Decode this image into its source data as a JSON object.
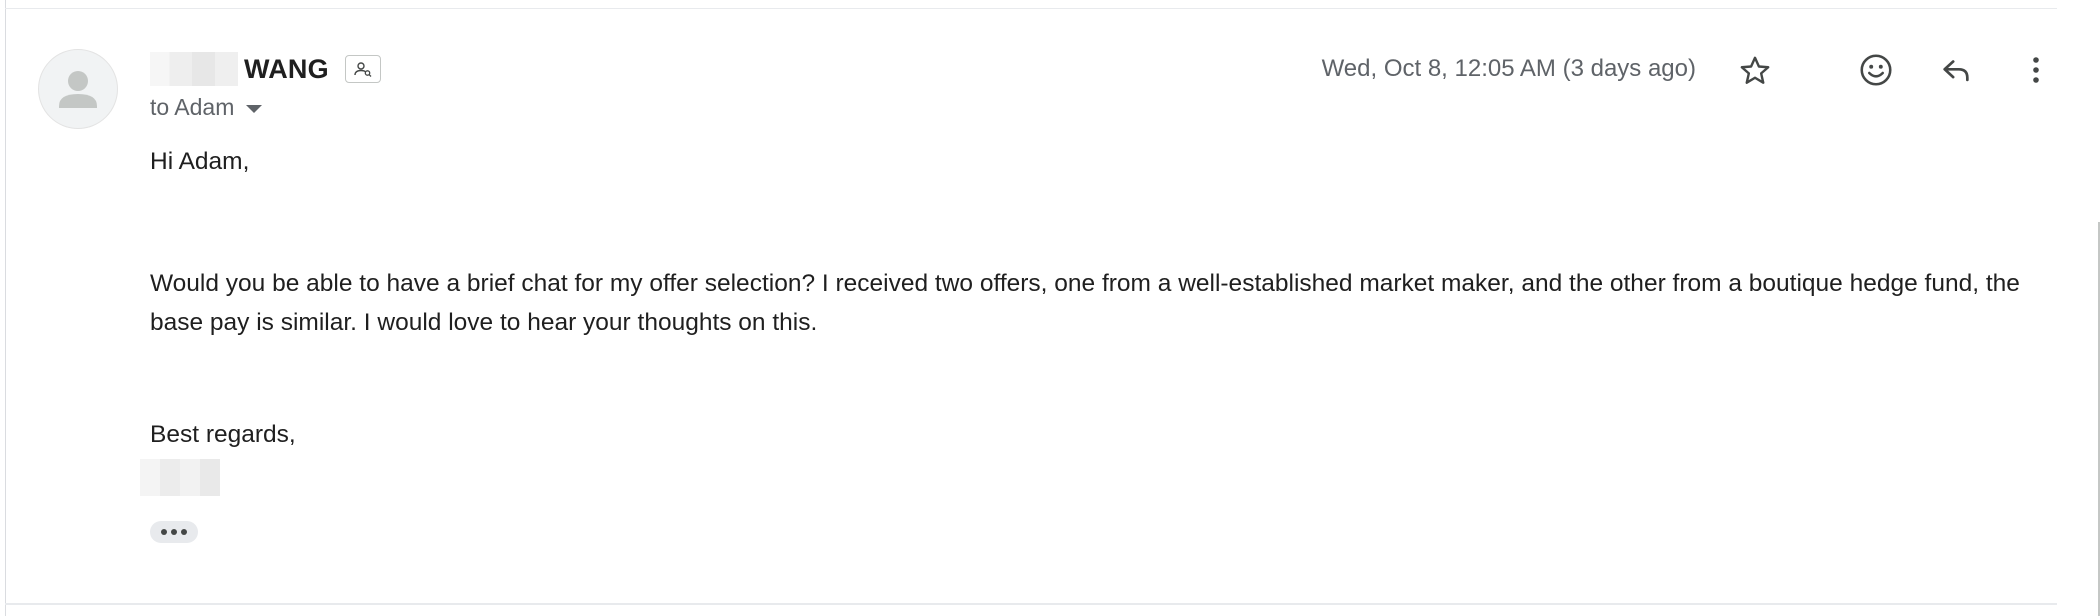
{
  "email": {
    "sender": {
      "name_visible": "WANG"
    },
    "recipient_line": "to Adam",
    "date": "Wed, Oct 8, 12:05 AM (3 days ago)",
    "body": {
      "greeting": "Hi Adam,",
      "paragraph": "Would you be able to have a brief chat for my offer selection? I received two offers, one from a well-established market maker, and the other from a boutique hedge fund, the base pay is similar. I would love to hear your thoughts on this.",
      "closing": "Best regards,"
    }
  },
  "icons": {
    "avatar": "person-icon",
    "contact": "contact-card-icon",
    "star": "star-icon",
    "emoji": "emoji-smile-icon",
    "reply": "reply-icon",
    "more": "more-vertical-icon",
    "expand": "ellipsis-icon"
  },
  "colors": {
    "text_primary": "#1f1f1f",
    "text_secondary": "#5f6368",
    "divider": "#e8eaed",
    "icon": "#444746"
  }
}
